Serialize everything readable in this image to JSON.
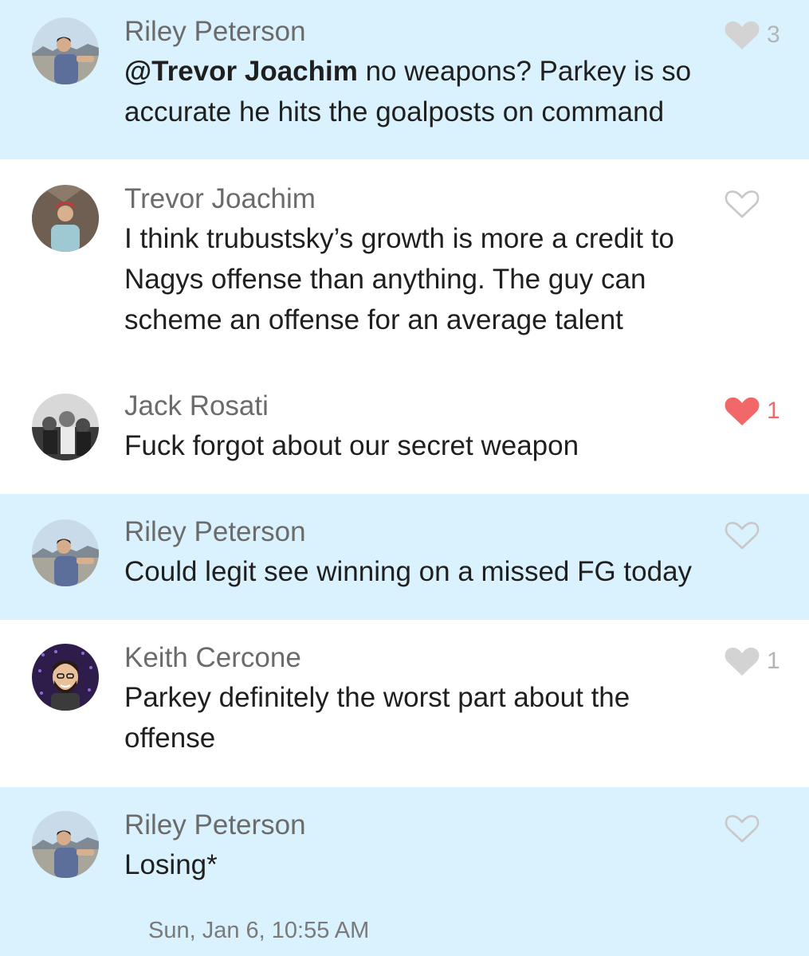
{
  "messages": [
    {
      "author": "Riley Peterson",
      "mention": "@Trevor Joachim",
      "text": " no weapons? Parkey is so accurate he hits the goalposts on command",
      "like_icon": "heart-filled-gray",
      "like_count": "3"
    },
    {
      "author": "Trevor Joachim",
      "text": "I think trubustsky’s growth is more a credit to Nagys offense than anything. The guy can scheme an offense for an average talent",
      "like_icon": "heart-outline",
      "like_count": ""
    },
    {
      "author": "Jack Rosati",
      "text": "Fuck forgot about our secret weapon",
      "like_icon": "heart-filled-red",
      "like_count": "1"
    },
    {
      "author": "Riley Peterson",
      "text": "Could legit see winning on a missed FG today",
      "like_icon": "heart-outline",
      "like_count": ""
    },
    {
      "author": "Keith Cercone",
      "text": "Parkey definitely the worst part about the offense",
      "like_icon": "heart-filled-gray",
      "like_count": "1"
    },
    {
      "author": "Riley Peterson",
      "text": "Losing*",
      "like_icon": "heart-outline",
      "like_count": ""
    }
  ],
  "timestamp": "Sun, Jan 6, 10:55 AM",
  "colors": {
    "own_message_bg": "#daf2fd",
    "like_red": "#f26767",
    "like_gray": "#d3d3d3",
    "heart_outline": "#c8c8c8"
  }
}
